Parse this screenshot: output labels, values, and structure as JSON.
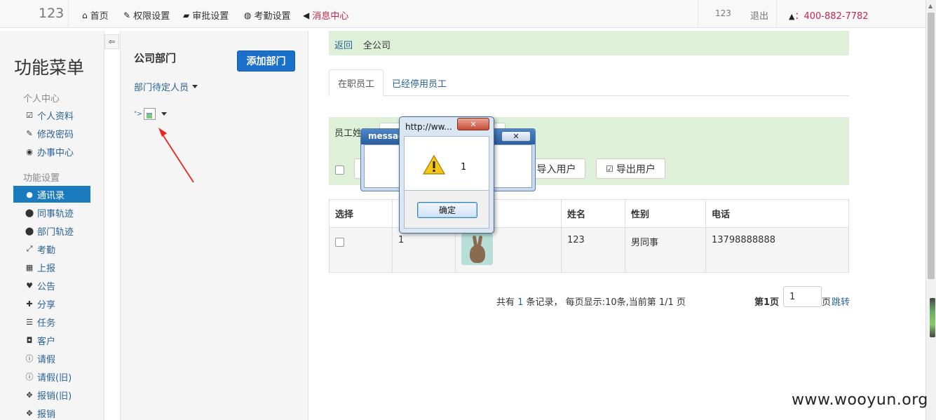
{
  "topbar": {
    "brand": "123",
    "nav": [
      {
        "icon": "home-icon",
        "glyph": "⌂",
        "label": "首页"
      },
      {
        "icon": "wrench-icon",
        "glyph": "✎",
        "label": "权限设置"
      },
      {
        "icon": "folder-open-icon",
        "glyph": "▰",
        "label": "审批设置"
      },
      {
        "icon": "globe-icon",
        "glyph": "◍",
        "label": "考勤设置"
      },
      {
        "icon": "bullhorn-icon",
        "glyph": "◀",
        "label": "消息中心"
      }
    ],
    "user": "123",
    "logout": "退出",
    "phone_icon": "bell-icon",
    "phone": "400-882-7782",
    "phone_prefix": "："
  },
  "sidebar": {
    "title": "功能菜单",
    "collapse_icon": "toggle-sidebar-icon",
    "sections": [
      {
        "heading": "个人中心",
        "items": [
          {
            "icon": "edit-icon",
            "glyph": "☑",
            "label": "个人资料"
          },
          {
            "icon": "pencil-icon",
            "glyph": "✎",
            "label": "修改密码"
          },
          {
            "icon": "check-circle-icon",
            "glyph": "◉",
            "label": "办事中心"
          }
        ]
      },
      {
        "heading": "功能设置",
        "items": [
          {
            "icon": "user-icon",
            "glyph": "●",
            "label": "通讯录",
            "active": true
          },
          {
            "icon": "map-marker-icon",
            "glyph": "⬤",
            "label": "同事轨迹"
          },
          {
            "icon": "map-marker-icon",
            "glyph": "⬤",
            "label": "部门轨迹"
          },
          {
            "icon": "resize-icon",
            "glyph": "⤢",
            "label": "考勤"
          },
          {
            "icon": "calendar-icon",
            "glyph": "▦",
            "label": "上报"
          },
          {
            "icon": "heart-icon",
            "glyph": "♥",
            "label": "公告"
          },
          {
            "icon": "gift-icon",
            "glyph": "✚",
            "label": "分享"
          },
          {
            "icon": "list-icon",
            "glyph": "☰",
            "label": "任务"
          },
          {
            "icon": "camera-icon",
            "glyph": "◘",
            "label": "客户"
          },
          {
            "icon": "info-icon",
            "glyph": "ⓘ",
            "label": "请假"
          },
          {
            "icon": "info-icon",
            "glyph": "ⓘ",
            "label": "请假(旧)"
          },
          {
            "icon": "move-icon",
            "glyph": "✥",
            "label": "报销(旧)"
          },
          {
            "icon": "move-icon",
            "glyph": "✥",
            "label": "报销"
          }
        ]
      }
    ]
  },
  "dept_panel": {
    "title": "公司部门",
    "add_button": "添加部门",
    "pending_link": "部门待定人员",
    "xss_fragment": "\">"
  },
  "main": {
    "breadcrumb": {
      "back": "返回",
      "current": "全公司"
    },
    "tabs": [
      {
        "label": "在职员工",
        "active": true
      },
      {
        "label": "已经停用员工",
        "active": false
      }
    ],
    "filter": {
      "label": "员工姓名",
      "import_button": "导入用户",
      "export_button": "导出用户"
    },
    "table": {
      "headers": [
        "选择",
        "",
        "",
        "姓名",
        "性别",
        "电话"
      ],
      "rows": [
        {
          "col2": "1",
          "name": "123",
          "gender": "男同事",
          "phone": "13798888888"
        }
      ]
    },
    "pagination": {
      "info_prefix": "共有 ",
      "total": "1",
      "info_mid": " 条记录，  每页显示:10条,当前第 ",
      "current": "1/1",
      "info_suffix": " 页",
      "current_page": "第1页",
      "page_value": "1",
      "page_unit": "页",
      "jump": "跳转"
    }
  },
  "dialogs": {
    "back": {
      "title": "messag",
      "close": "✕"
    },
    "front": {
      "title": "http://ww...",
      "close": "✕",
      "message": "1",
      "ok": "确定",
      "icon": "warning-icon"
    }
  },
  "watermark": "www.wooyun.org"
}
